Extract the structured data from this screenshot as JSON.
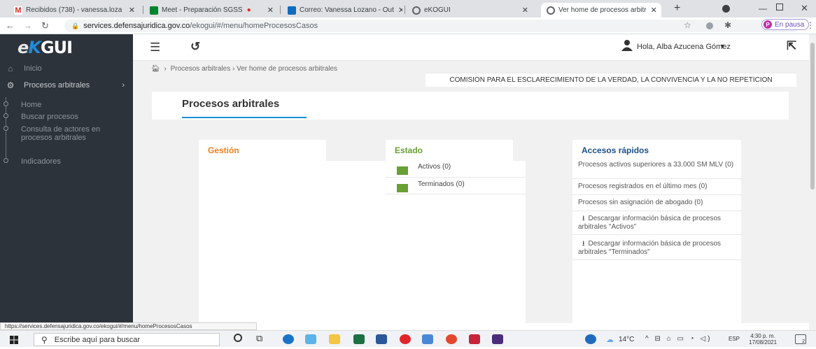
{
  "browser": {
    "tabs": [
      {
        "title": "Recibidos (738) - vanessa.loza",
        "color": "#d93025"
      },
      {
        "title": "Meet - Preparación SGSS",
        "color": "#00832d"
      },
      {
        "title": "Correo: Vanessa Lozano - Out",
        "color": "#0f6cbd"
      },
      {
        "title": "eKOGUI",
        "color": "#5f6368"
      },
      {
        "title": "Ver home de procesos arbitr",
        "color": "#5f6368"
      }
    ],
    "new_tab": "+",
    "url_host": "services.defensajuridica.gov.co",
    "url_path": "/ekogui/#/menu/homeProcesosCasos",
    "profile_label": "En pausa",
    "profile_initial": "P"
  },
  "app": {
    "logo_e": "e",
    "logo_k": "K",
    "logo_gui": "GUI",
    "user_greeting": "Hola, Alba Azucena Gómez",
    "sidebar": {
      "inicio": "Inicio",
      "procesos": "Procesos arbitrales",
      "subitems": [
        "Home",
        "Buscar procesos",
        "Consulta de actores en procesos arbitrales",
        "Indicadores"
      ]
    },
    "breadcrumb": "Procesos arbitrales › Ver home de procesos arbitrales",
    "organization": "COMISION PARA EL ESCLARECIMIENTO DE LA VERDAD, LA CONVIVENCIA Y LA NO REPETICION",
    "page_tab": "Procesos arbitrales",
    "gestion": {
      "title": "Gestión",
      "color": "#f07e1b"
    },
    "estado": {
      "title": "Estado",
      "color": "#68a033",
      "items": [
        "Activos (0)",
        "Terminados (0)"
      ]
    },
    "accesos": {
      "title": "Accesos rápidos",
      "color": "#1a4f8a",
      "items": [
        "Procesos activos superiores a 33.000 SM MLV (0)",
        "Procesos registrados en el último mes (0)",
        "Procesos sin asignación de abogado (0)",
        "Descargar información básica de procesos arbitrales \"Activos\"",
        "Descargar información básica de procesos arbitrales \"Terminados\""
      ]
    }
  },
  "status_url": "https://services.defensajuridica.gov.co/ekogui/#/menu/homeProcesosCasos",
  "taskbar": {
    "search_placeholder": "Escribe aquí para buscar",
    "weather": "14°C",
    "lang": "ESP",
    "time": "4:30 p. m.",
    "date": "17/08/2021",
    "notifications": "2"
  }
}
